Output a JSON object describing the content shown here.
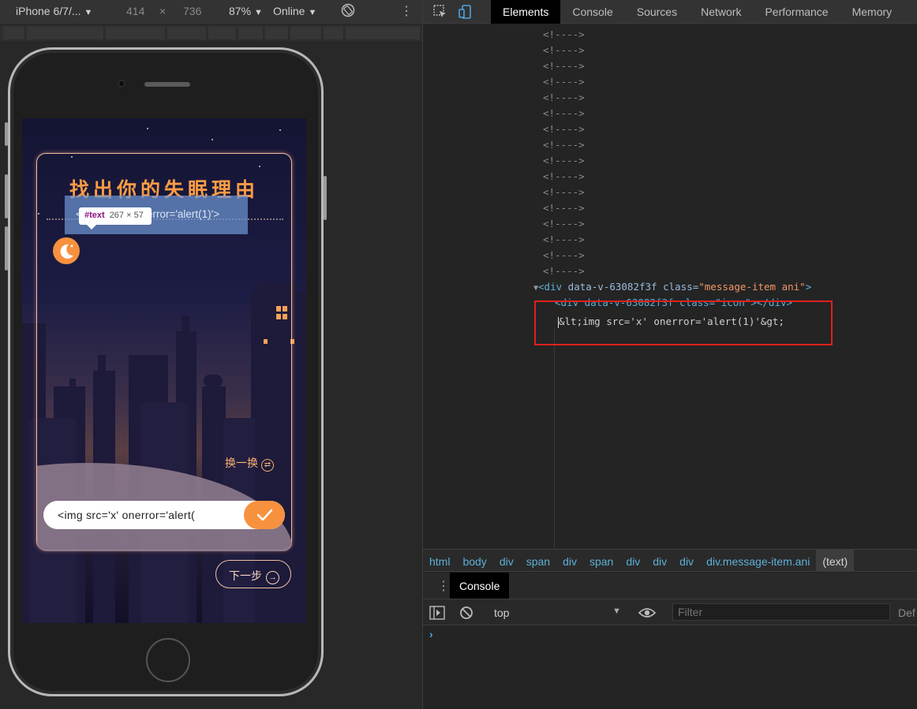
{
  "device_toolbar": {
    "device": "iPhone 6/7/...",
    "width": "414",
    "times": "×",
    "height": "736",
    "zoom": "87%",
    "network": "Online"
  },
  "app": {
    "title": "找出你的失眠理由",
    "tooltip_tag": "#text",
    "tooltip_size": "267 × 57",
    "message": "<img src='x' onerror='alert(1)'>",
    "swap_label": "换一换",
    "answer_value": "<img src='x' onerror='alert(",
    "next_label": "下一步"
  },
  "devtools": {
    "tabs": [
      "Elements",
      "Console",
      "Sources",
      "Network",
      "Performance",
      "Memory"
    ],
    "comment": "<!---->",
    "node_open": "<div",
    "node_attr1_name": "data-v-63082f3f",
    "node_attr2_name": "class=",
    "node_attr2_value": "\"message-item ani\"",
    "node_close": ">",
    "child_line": "<div data-v-63082f3f class=\"icon\"></div>",
    "text_node": "&lt;img src='x' onerror='alert(1)'&gt;",
    "breadcrumbs": [
      "html",
      "body",
      "div",
      "span",
      "div",
      "span",
      "div",
      "div",
      "div",
      "div.message-item.ani",
      "(text)"
    ],
    "drawer_tab": "Console",
    "context": "top",
    "filter_placeholder": "Filter",
    "levels_label": "Def",
    "prompt": "›"
  },
  "colors": {
    "accent_orange": "#f7913e",
    "highlight_red": "#e0201c",
    "devtools_tag": "#5db0d7",
    "devtools_value": "#f29766"
  }
}
